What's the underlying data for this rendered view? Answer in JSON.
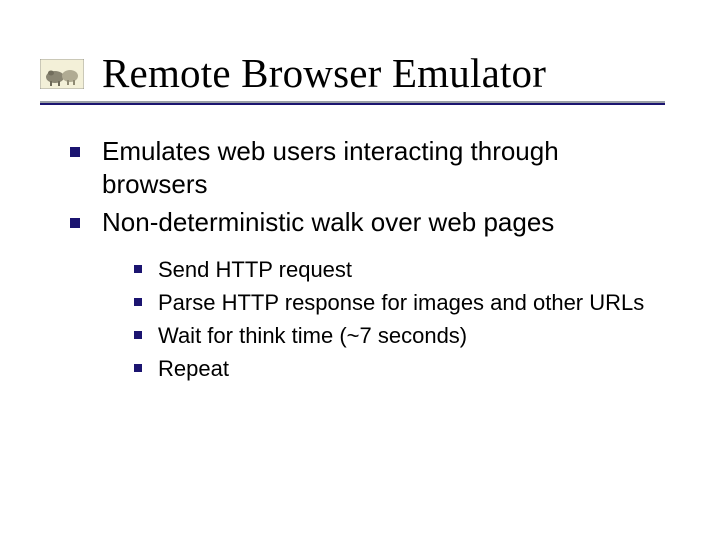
{
  "title": "Remote Browser Emulator",
  "bullets": {
    "b0": "Emulates web users interacting through browsers",
    "b1": "Non-deterministic walk over web pages",
    "sub": {
      "s0": "Send HTTP request",
      "s1": "Parse HTTP response for images and other URLs",
      "s2": "Wait for think time (~7 seconds)",
      "s3": "Repeat"
    }
  }
}
